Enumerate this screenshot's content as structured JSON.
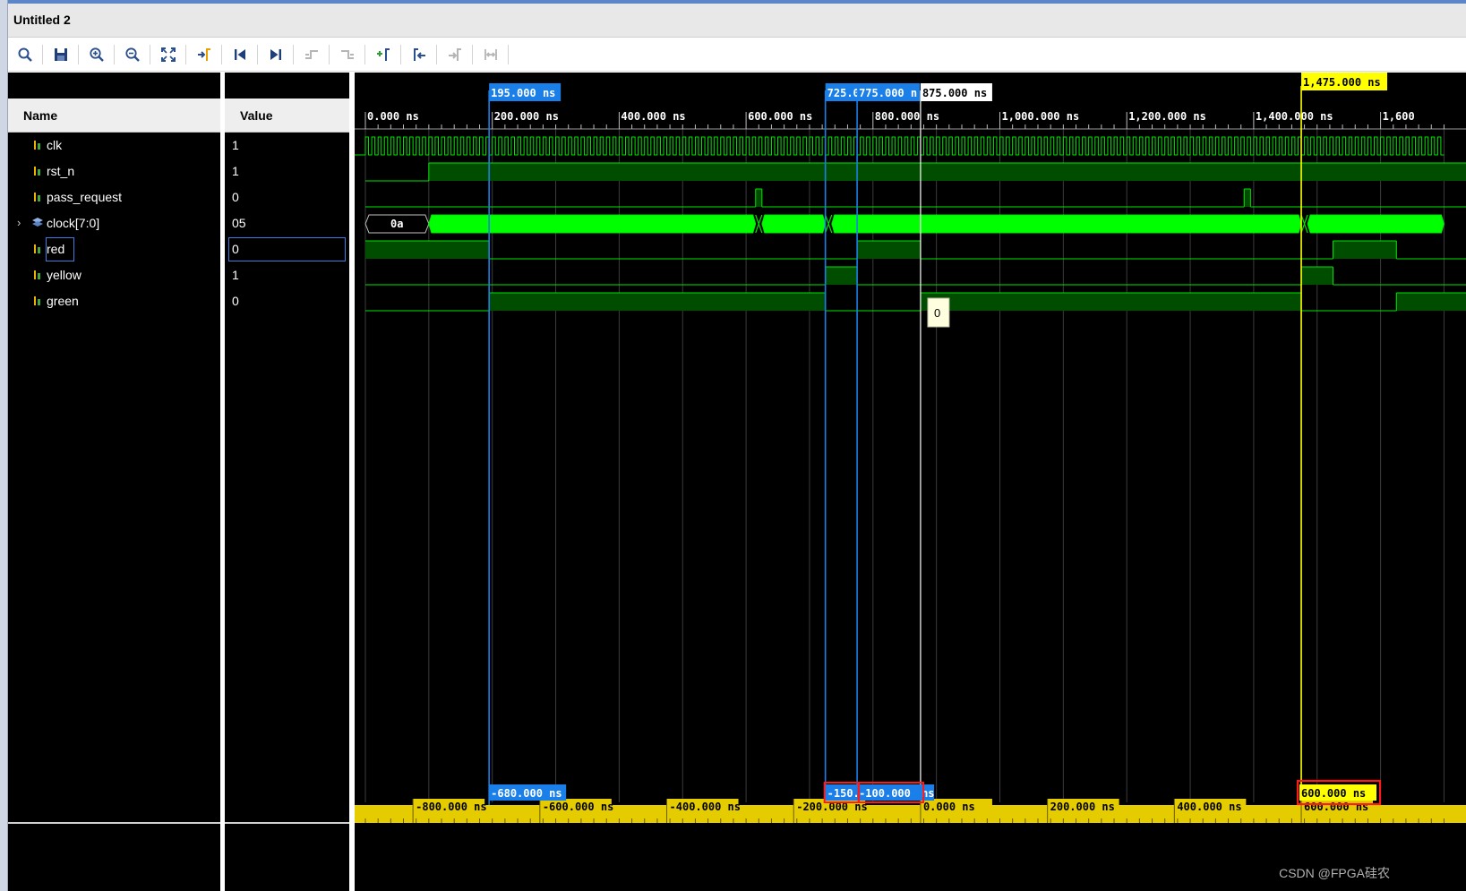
{
  "window": {
    "title": "Untitled 2"
  },
  "toolbar": {
    "buttons": [
      {
        "name": "search-icon",
        "enabled": true
      },
      {
        "name": "save-icon",
        "enabled": true
      },
      {
        "name": "zoom-in-icon",
        "enabled": true
      },
      {
        "name": "zoom-out-icon",
        "enabled": true
      },
      {
        "name": "zoom-fit-icon",
        "enabled": true
      },
      {
        "name": "go-to-cursor-icon",
        "enabled": true
      },
      {
        "name": "go-to-time-zero-icon",
        "enabled": true
      },
      {
        "name": "go-to-last-time-icon",
        "enabled": true
      },
      {
        "name": "previous-transition-icon",
        "enabled": false
      },
      {
        "name": "next-transition-icon",
        "enabled": false
      },
      {
        "name": "add-marker-icon",
        "enabled": true
      },
      {
        "name": "previous-marker-icon",
        "enabled": true
      },
      {
        "name": "next-marker-icon",
        "enabled": false
      },
      {
        "name": "swap-cursors-icon",
        "enabled": false
      }
    ]
  },
  "columns": {
    "name": "Name",
    "value": "Value"
  },
  "signals": [
    {
      "name": "clk",
      "value": "1",
      "kind": "bit"
    },
    {
      "name": "rst_n",
      "value": "1",
      "kind": "bit"
    },
    {
      "name": "pass_request",
      "value": "0",
      "kind": "bit"
    },
    {
      "name": "clock[7:0]",
      "value": "05",
      "kind": "bus",
      "expandable": true
    },
    {
      "name": "red",
      "value": "0",
      "kind": "bit",
      "selected": true
    },
    {
      "name": "yellow",
      "value": "1",
      "kind": "bit"
    },
    {
      "name": "green",
      "value": "0",
      "kind": "bit"
    }
  ],
  "timeline": {
    "ticks_ns": [
      0,
      200,
      400,
      600,
      800,
      1000,
      1200,
      1400,
      1600
    ],
    "tick_labels": [
      "0.000 ns",
      "200.000 ns",
      "400.000 ns",
      "600.000 ns",
      "800.000 ns",
      "1,000.000 ns",
      "1,200.000 ns",
      "1,400.000 ns",
      "1,600"
    ],
    "view_start_ns": 0,
    "view_end_ns": 1650
  },
  "markers": [
    {
      "label": "195.000 ns",
      "time_ns": 195,
      "color": "#1a7fe8"
    },
    {
      "label": "725.0",
      "time_ns": 725,
      "color": "#1a7fe8"
    },
    {
      "label": "775.000 n",
      "time_ns": 775,
      "color": "#1a7fe8"
    },
    {
      "label": "875.000 ns",
      "time_ns": 875,
      "color": "#ffffff"
    },
    {
      "label": "1,475.000 ns",
      "time_ns": 1475,
      "color": "#ffff00"
    }
  ],
  "bus_values": {
    "clock_initial": "0a"
  },
  "tooltip": {
    "value": "0"
  },
  "relative_ruler": {
    "labels": [
      "-800.000 ns",
      "-600.000 ns",
      "-400.000 ns",
      "-200.000 ns",
      "0.000 ns",
      "200.000 ns",
      "400.000 ns",
      "600.000 ns"
    ],
    "delta_labels": [
      "-680.000 ns",
      "-150.",
      "-100.000",
      "ns",
      "600.000 ns"
    ]
  },
  "watermark": "CSDN @FPGA硅农",
  "colors": {
    "wave": "#00e400",
    "bus_fill": "#00ff00",
    "marker_blue": "#1a7fe8",
    "marker_yellow": "#ffff00",
    "ruler": "#e4cc00",
    "highlight_red": "#ff1a1a"
  }
}
